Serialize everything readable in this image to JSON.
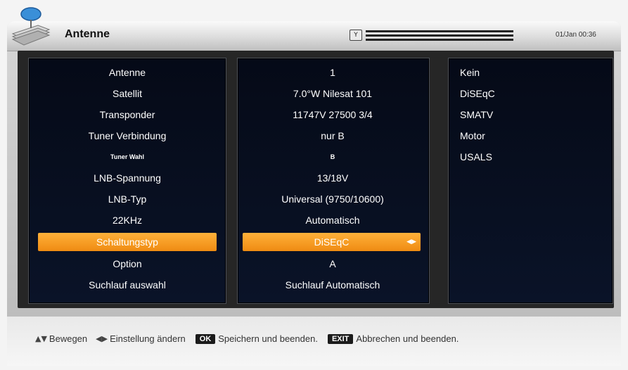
{
  "header": {
    "title": "Antenne",
    "datetime": "01/Jan 00:36",
    "signal_icon": "Y"
  },
  "settings": [
    {
      "label": "Antenne",
      "value": "1"
    },
    {
      "label": "Satellit",
      "value": "7.0°W Nilesat 101"
    },
    {
      "label": "Transponder",
      "value": "11747V 27500 3/4"
    },
    {
      "label": "Tuner Verbindung",
      "value": "nur B"
    },
    {
      "label": "Tuner Wahl",
      "value": "B"
    },
    {
      "label": "LNB-Spannung",
      "value": "13/18V"
    },
    {
      "label": "LNB-Typ",
      "value": "Universal (9750/10600)"
    },
    {
      "label": "22KHz",
      "value": "Automatisch"
    },
    {
      "label": "Schaltungstyp",
      "value": "DiSEqC",
      "selected": true
    },
    {
      "label": "Option",
      "value": "A"
    },
    {
      "label": "Suchlauf auswahl",
      "value": "Suchlauf Automatisch"
    }
  ],
  "options": [
    "Kein",
    "DiSEqC",
    "SMATV",
    "Motor",
    "USALS"
  ],
  "footer": {
    "move": "Bewegen",
    "change": "Einstellung ändern",
    "ok_key": "OK",
    "ok_text": "Speichern und beenden.",
    "exit_key": "EXIT",
    "exit_text": "Abbrechen und beenden."
  },
  "colors": {
    "highlight": "#f59a22",
    "panel_bg": "#07101f",
    "frame": "#cfcfcf"
  }
}
